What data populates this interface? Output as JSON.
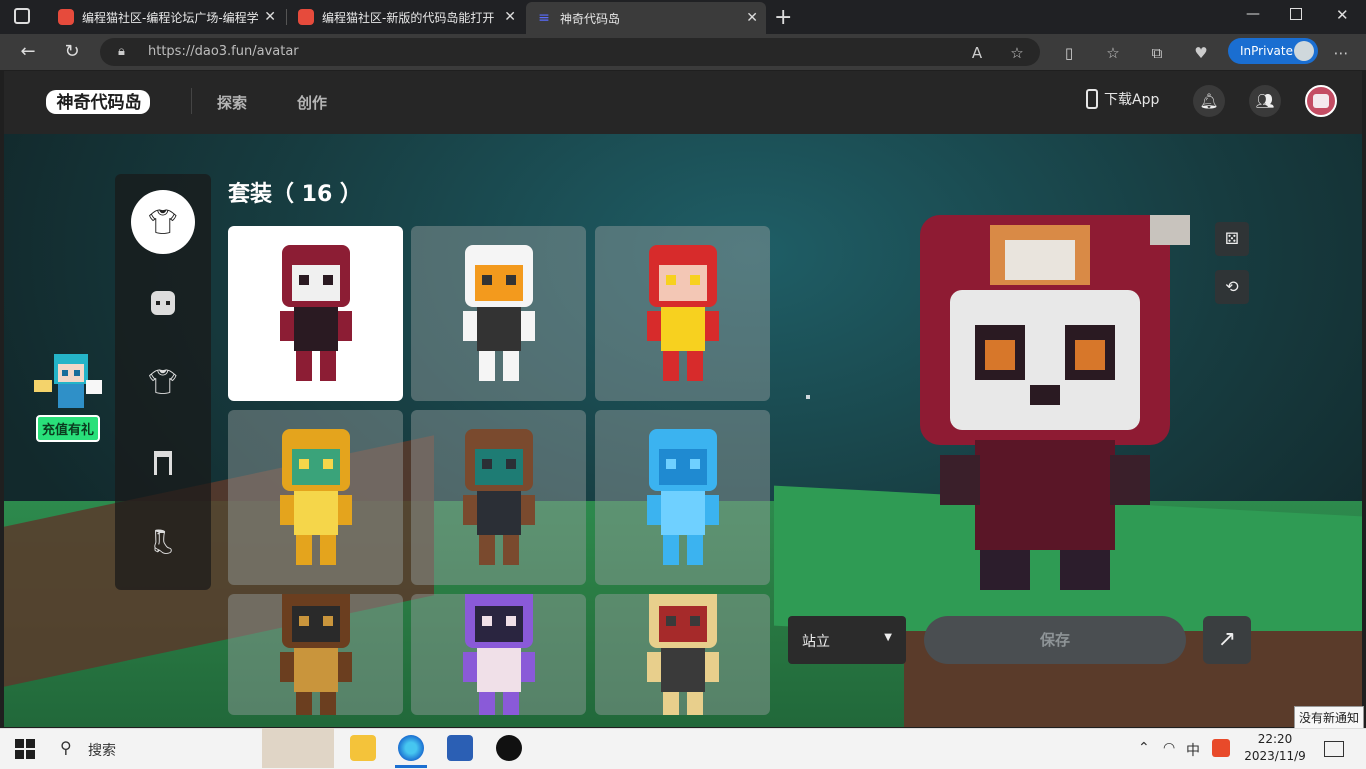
{
  "browser": {
    "tabs": [
      {
        "title": "编程猫社区-编程论坛广场-编程学",
        "active": false
      },
      {
        "title": "编程猫社区-新版的代码岛能打开",
        "active": false
      },
      {
        "title": "神奇代码岛",
        "active": true
      }
    ],
    "url": "https://dao3.fun/avatar",
    "inprivate_label": "InPrivate"
  },
  "header": {
    "logo_text": "神奇代码岛",
    "nav": [
      "探索",
      "创作"
    ],
    "download_app": "下载App"
  },
  "sidebar": {
    "categories": [
      {
        "name": "outfit",
        "icon": "outfit-icon",
        "active": true
      },
      {
        "name": "face",
        "icon": "face-icon",
        "active": false
      },
      {
        "name": "top",
        "icon": "shirt-icon",
        "active": false
      },
      {
        "name": "bottom",
        "icon": "pants-icon",
        "active": false
      },
      {
        "name": "shoes",
        "icon": "shoe-icon",
        "active": false
      }
    ]
  },
  "gift": {
    "label": "充值有礼"
  },
  "outfits": {
    "title": "套装（ 16 ）",
    "items": [
      {
        "name": "reaper-skull",
        "selected": true,
        "colors": [
          "#8c1d34",
          "#f0f0f0",
          "#2a1a22"
        ]
      },
      {
        "name": "astronaut",
        "selected": false,
        "colors": [
          "#f5f5f5",
          "#f39a1d",
          "#333333"
        ]
      },
      {
        "name": "red-cat-hero",
        "selected": false,
        "colors": [
          "#d72b2b",
          "#f3c7b5",
          "#f7d11f"
        ]
      },
      {
        "name": "tiger-hood",
        "selected": false,
        "colors": [
          "#e4a41d",
          "#3aa37a",
          "#f5d64a"
        ]
      },
      {
        "name": "teal-jacket-boy",
        "selected": false,
        "colors": [
          "#7a4a2e",
          "#1e7c74",
          "#2b2f36"
        ]
      },
      {
        "name": "blue-crystal",
        "selected": false,
        "colors": [
          "#3bb3f0",
          "#1f8ad1",
          "#6fd0ff"
        ]
      },
      {
        "name": "samurai-cat",
        "selected": false,
        "colors": [
          "#6b3e1f",
          "#2a2a2a",
          "#c9953c"
        ]
      },
      {
        "name": "purple-hair-girl",
        "selected": false,
        "colors": [
          "#8a5ad8",
          "#2a2540",
          "#f0e0e8"
        ]
      },
      {
        "name": "blonde-boy",
        "selected": false,
        "colors": [
          "#e8cf8c",
          "#a62a2a",
          "#3a3a3a"
        ]
      }
    ]
  },
  "controls": {
    "pose": "站立",
    "save": "保存"
  },
  "taskbar": {
    "search": "搜索",
    "ime": "中",
    "time": "22:20",
    "date": "2023/11/9",
    "notification": "没有新通知"
  }
}
